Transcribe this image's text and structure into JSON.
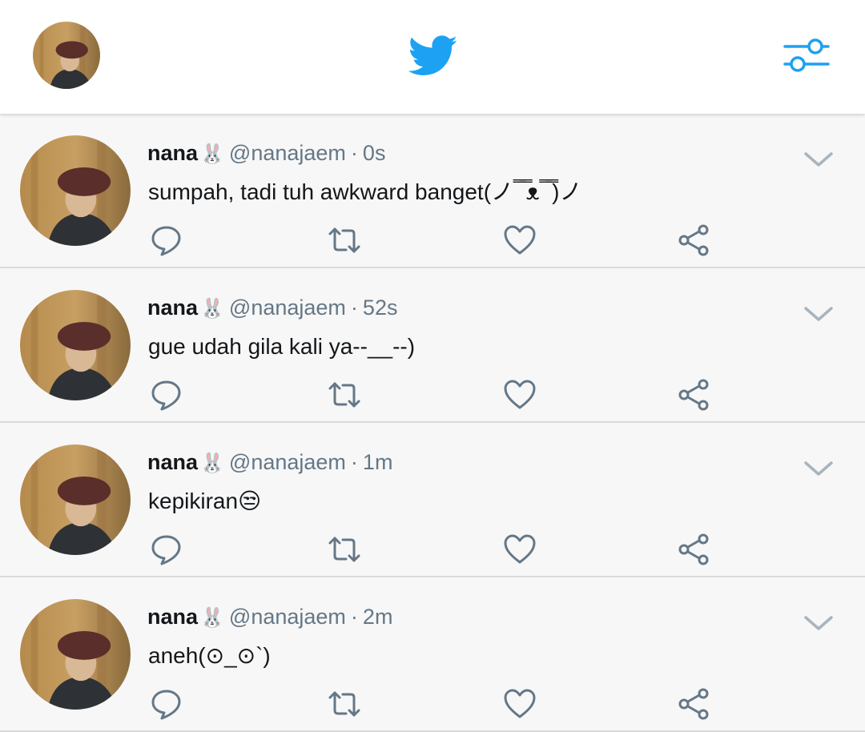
{
  "app": {
    "name": "Twitter"
  },
  "colors": {
    "brand": "#1da1f2",
    "icon_gray": "#657786",
    "text": "#14171a"
  },
  "header": {
    "logo_icon": "twitter-bird-icon",
    "filter_icon": "sliders-icon"
  },
  "tweets": [
    {
      "name": "nana",
      "emoji": "🐰",
      "handle": "@nanajaem",
      "time": "0s",
      "text": "sumpah, tadi tuh awkward banget(ノ ̿ ̿ᴥ ̿ ̿)ノ"
    },
    {
      "name": "nana",
      "emoji": "🐰",
      "handle": "@nanajaem",
      "time": "52s",
      "text": "gue udah gila kali ya--__--)"
    },
    {
      "name": "nana",
      "emoji": "🐰",
      "handle": "@nanajaem",
      "time": "1m",
      "text": "kepikiran😒"
    },
    {
      "name": "nana",
      "emoji": "🐰",
      "handle": "@nanajaem",
      "time": "2m",
      "text": "aneh(⊙_⊙`)"
    }
  ],
  "separator": "·"
}
